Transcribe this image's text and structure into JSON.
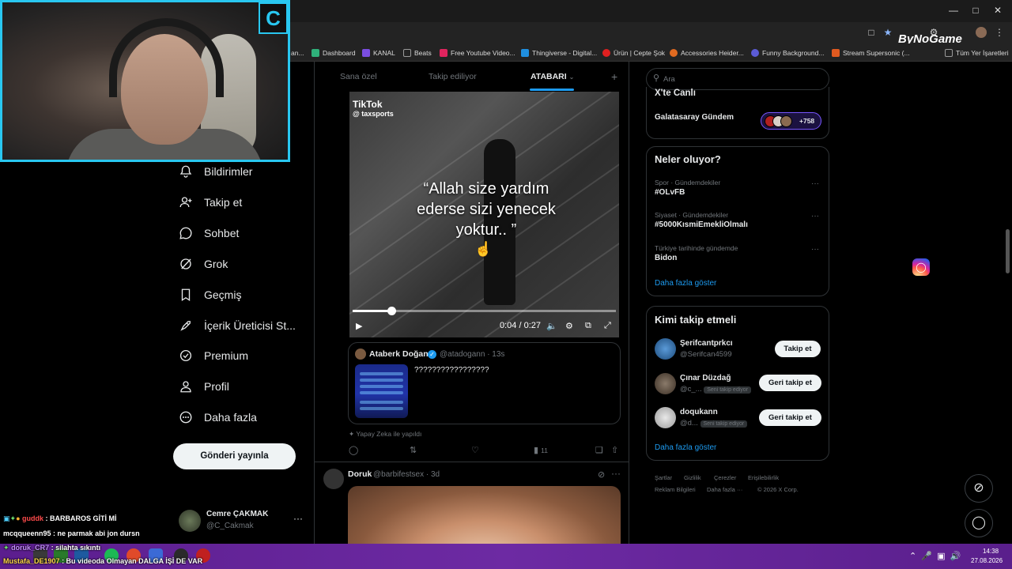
{
  "browser": {
    "brand": "ByNoGame",
    "bookmarks": [
      {
        "label": "an...",
        "color": "#444"
      },
      {
        "label": "Dashboard",
        "color": "#2fb07a"
      },
      {
        "label": "KANAL",
        "color": "#7a4de0"
      },
      {
        "label": "Beats",
        "color": "#9a9a9a"
      },
      {
        "label": "Free Youtube Video...",
        "color": "#e0245e"
      },
      {
        "label": "Thingiverse - Digital...",
        "color": "#1f8fe0"
      },
      {
        "label": "Ürün | Cepte Şok",
        "color": "#e02020"
      },
      {
        "label": "Accessories Heider...",
        "color": "#e06a20"
      },
      {
        "label": "Funny Background...",
        "color": "#5b5bd6"
      },
      {
        "label": "Stream Supersonic (...",
        "color": "#e05a20"
      }
    ],
    "all_bookmarks": "Tüm Yer İşaretleri"
  },
  "nav": {
    "items": [
      {
        "label": "Bildirimler",
        "icon": "bell-icon"
      },
      {
        "label": "Takip et",
        "icon": "person-plus-icon"
      },
      {
        "label": "Sohbet",
        "icon": "chat-icon"
      },
      {
        "label": "Grok",
        "icon": "grok-icon"
      },
      {
        "label": "Geçmiş",
        "icon": "bookmark-icon"
      },
      {
        "label": "İçerik Üreticisi St...",
        "icon": "rocket-icon"
      },
      {
        "label": "Premium",
        "icon": "verified-icon"
      },
      {
        "label": "Profil",
        "icon": "person-icon"
      },
      {
        "label": "Daha fazla",
        "icon": "more-circle-icon"
      }
    ],
    "post_button": "Gönderi yayınla",
    "account": {
      "name": "Cemre ÇAKMAK",
      "handle": "@C_Cakmak"
    }
  },
  "chat": [
    {
      "user": "guddk",
      "msg": ": BARBAROS GİTİ Mİ",
      "user_color": "#ff4b4b"
    },
    {
      "user": "mcqqueenn95",
      "msg": ": ne parmak abi jon dursn",
      "user_color": "#ffffff"
    },
    {
      "user": "doruk_CR7",
      "msg": ": silahta sıkıntı",
      "user_color": "#c58cff"
    },
    {
      "user": "Mustafa_DE1907",
      "msg": ": Bu videoda Olmayan DALGA İŞİ DE VAR",
      "user_color": "#ffd84b"
    }
  ],
  "timeline": {
    "tabs": [
      "Sana özel",
      "Takip ediliyor",
      "ATABARI"
    ],
    "add_tab": "+",
    "video": {
      "watermark": "TikTok",
      "watermark_handle": "@ taxsports",
      "caption_line1": "“Allah size yardım",
      "caption_line2": "ederse sizi yenecek",
      "caption_line3": "yoktur.. ”",
      "emoji": "☝️",
      "time": "0:04 / 0:27",
      "progress": 0.148
    },
    "quoted": {
      "name": "Ataberk Doğan",
      "handle_time": "@atadogann · 13s",
      "text": "?????????????????"
    },
    "ai_note": "Yapay Zeka ile yapıldı",
    "actions": {
      "views": "11"
    },
    "next_tweet": {
      "name": "Doruk",
      "handle_time": "@barbifestsex · 3d"
    }
  },
  "right": {
    "search_placeholder": "Ara",
    "community": {
      "title": "X'te Canlı",
      "name": "Galatasaray Gündem",
      "count": "+758"
    },
    "trends": {
      "title": "Neler oluyor?",
      "items": [
        {
          "meta": "Spor · Gündemdekiler",
          "name": "#OLvFB"
        },
        {
          "meta": "Siyaset · Gündemdekiler",
          "name": "#5000KısmiEmekliOlmalı"
        },
        {
          "meta": "Türkiye tarihinde gündemde",
          "name": "Bidon"
        }
      ],
      "show_more": "Daha fazla göster"
    },
    "who_to_follow": {
      "title": "Kimi takip etmeli",
      "items": [
        {
          "name": "Şerifcantprkcı",
          "handle": "@Serifcan4599",
          "follows_you": "",
          "button": "Takip et"
        },
        {
          "name": "Çınar Düzdağ",
          "handle": "@c_...",
          "follows_you": "Seni takip ediyor",
          "button": "Geri takip et"
        },
        {
          "name": "doqukann",
          "handle": "@d...",
          "follows_you": "Seni takip ediyor",
          "button": "Geri takip et"
        }
      ],
      "show_more": "Daha fazla göster"
    },
    "footer": {
      "line1": [
        "Şartlar",
        "Gizlilik",
        "Çerezler",
        "Erişilebilirlik"
      ],
      "line2": [
        "Reklam Bilgileri",
        "Daha fazla ···",
        "© 2026 X Corp."
      ]
    }
  },
  "taskbar": {
    "time": "14:38",
    "date": "27.08.2026"
  },
  "colors": {
    "accent": "#1d9bf0",
    "webcam_border": "#29c7f0",
    "taskbar": "#6d2aa3"
  }
}
